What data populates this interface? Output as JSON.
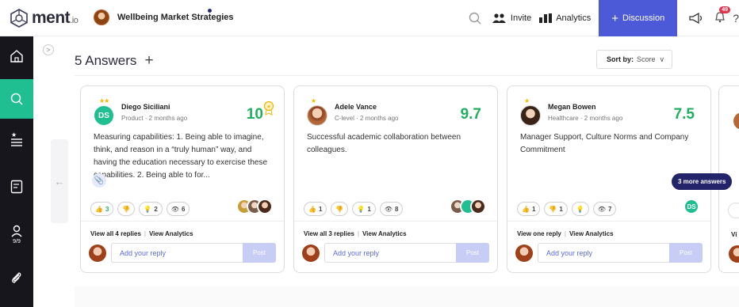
{
  "app": {
    "logo_text": "ment",
    "logo_suffix": ".io"
  },
  "project": {
    "title": "Wellbeing Market Strategies"
  },
  "topnav": {
    "invite_label": "Invite",
    "analytics_label": "Analytics",
    "discussion_label": "Discussion",
    "notification_count": "49",
    "help_label": "?"
  },
  "sidebar": {
    "items": [
      {
        "icon": "home-icon"
      },
      {
        "icon": "search-icon",
        "active": true
      },
      {
        "icon": "starred-list-icon"
      },
      {
        "icon": "notes-icon"
      },
      {
        "icon": "user-icon",
        "sub": "9/9"
      },
      {
        "icon": "paperclip-icon"
      }
    ],
    "collapse_label": ">"
  },
  "main": {
    "heading": "5 Answers",
    "add_label": "+",
    "sort": {
      "label": "Sort by:",
      "value": "Score"
    },
    "more_answers": "3 more answers"
  },
  "answers": [
    {
      "name": "Diego Siciliani",
      "meta": "Product · 2 months ago",
      "score": "10",
      "avatar_initials": "DS",
      "body": "Measuring capabilities:  1. Being able to imagine, think, and reason in a “truly human” way, and having the education necessary to exercise these capabilities. 2. Being able to for...",
      "likes": "3",
      "ideas": "2",
      "views": "6",
      "links_replies": "View all 4 replies",
      "links_analytics": "View Analytics",
      "reply_placeholder": "Add your reply",
      "post_label": "Post"
    },
    {
      "name": "Adele Vance",
      "meta": "C-level · 2 months ago",
      "score": "9.7",
      "body": "Successful academic collaboration between colleagues.",
      "likes": "1",
      "ideas": "1",
      "views": "8",
      "links_replies": "View all 3 replies",
      "links_analytics": "View Analytics",
      "reply_placeholder": "Add your reply",
      "post_label": "Post"
    },
    {
      "name": "Megan Bowen",
      "meta": "Healthcare · 2 months ago",
      "score": "7.5",
      "body": "Manager Support, Culture Norms and Company Commitment",
      "likes": "1",
      "dislikes": "1",
      "views": "7",
      "reactor_initials": "DS",
      "links_replies": "View one reply",
      "links_analytics": "View Analytics",
      "reply_placeholder": "Add your reply",
      "post_label": "Post"
    }
  ],
  "card4": {
    "links_partial": "Vi"
  },
  "colors": {
    "accent": "#4c5ad8",
    "green": "#1fbf91",
    "score": "#1faf5e",
    "dark": "#16161c"
  }
}
